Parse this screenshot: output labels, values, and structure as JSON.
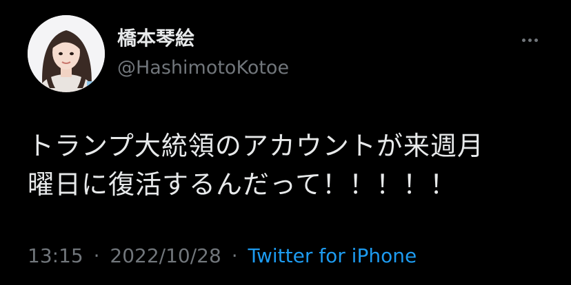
{
  "user": {
    "display_name": "橋本琴絵",
    "handle": "@HashimotoKotoe"
  },
  "tweet": {
    "text_line1": "トランプ大統領のアカウントが来週月",
    "text_line2": "曜日に復活するんだって！！！！！",
    "time": "13:15",
    "date": "2022/10/28",
    "separator": "·",
    "source": "Twitter for iPhone"
  },
  "icons": {
    "more": "more-horizontal-icon"
  },
  "colors": {
    "background": "#000000",
    "primary_text": "#e7e9ea",
    "secondary_text": "#71767b",
    "link": "#1d9bf0"
  }
}
